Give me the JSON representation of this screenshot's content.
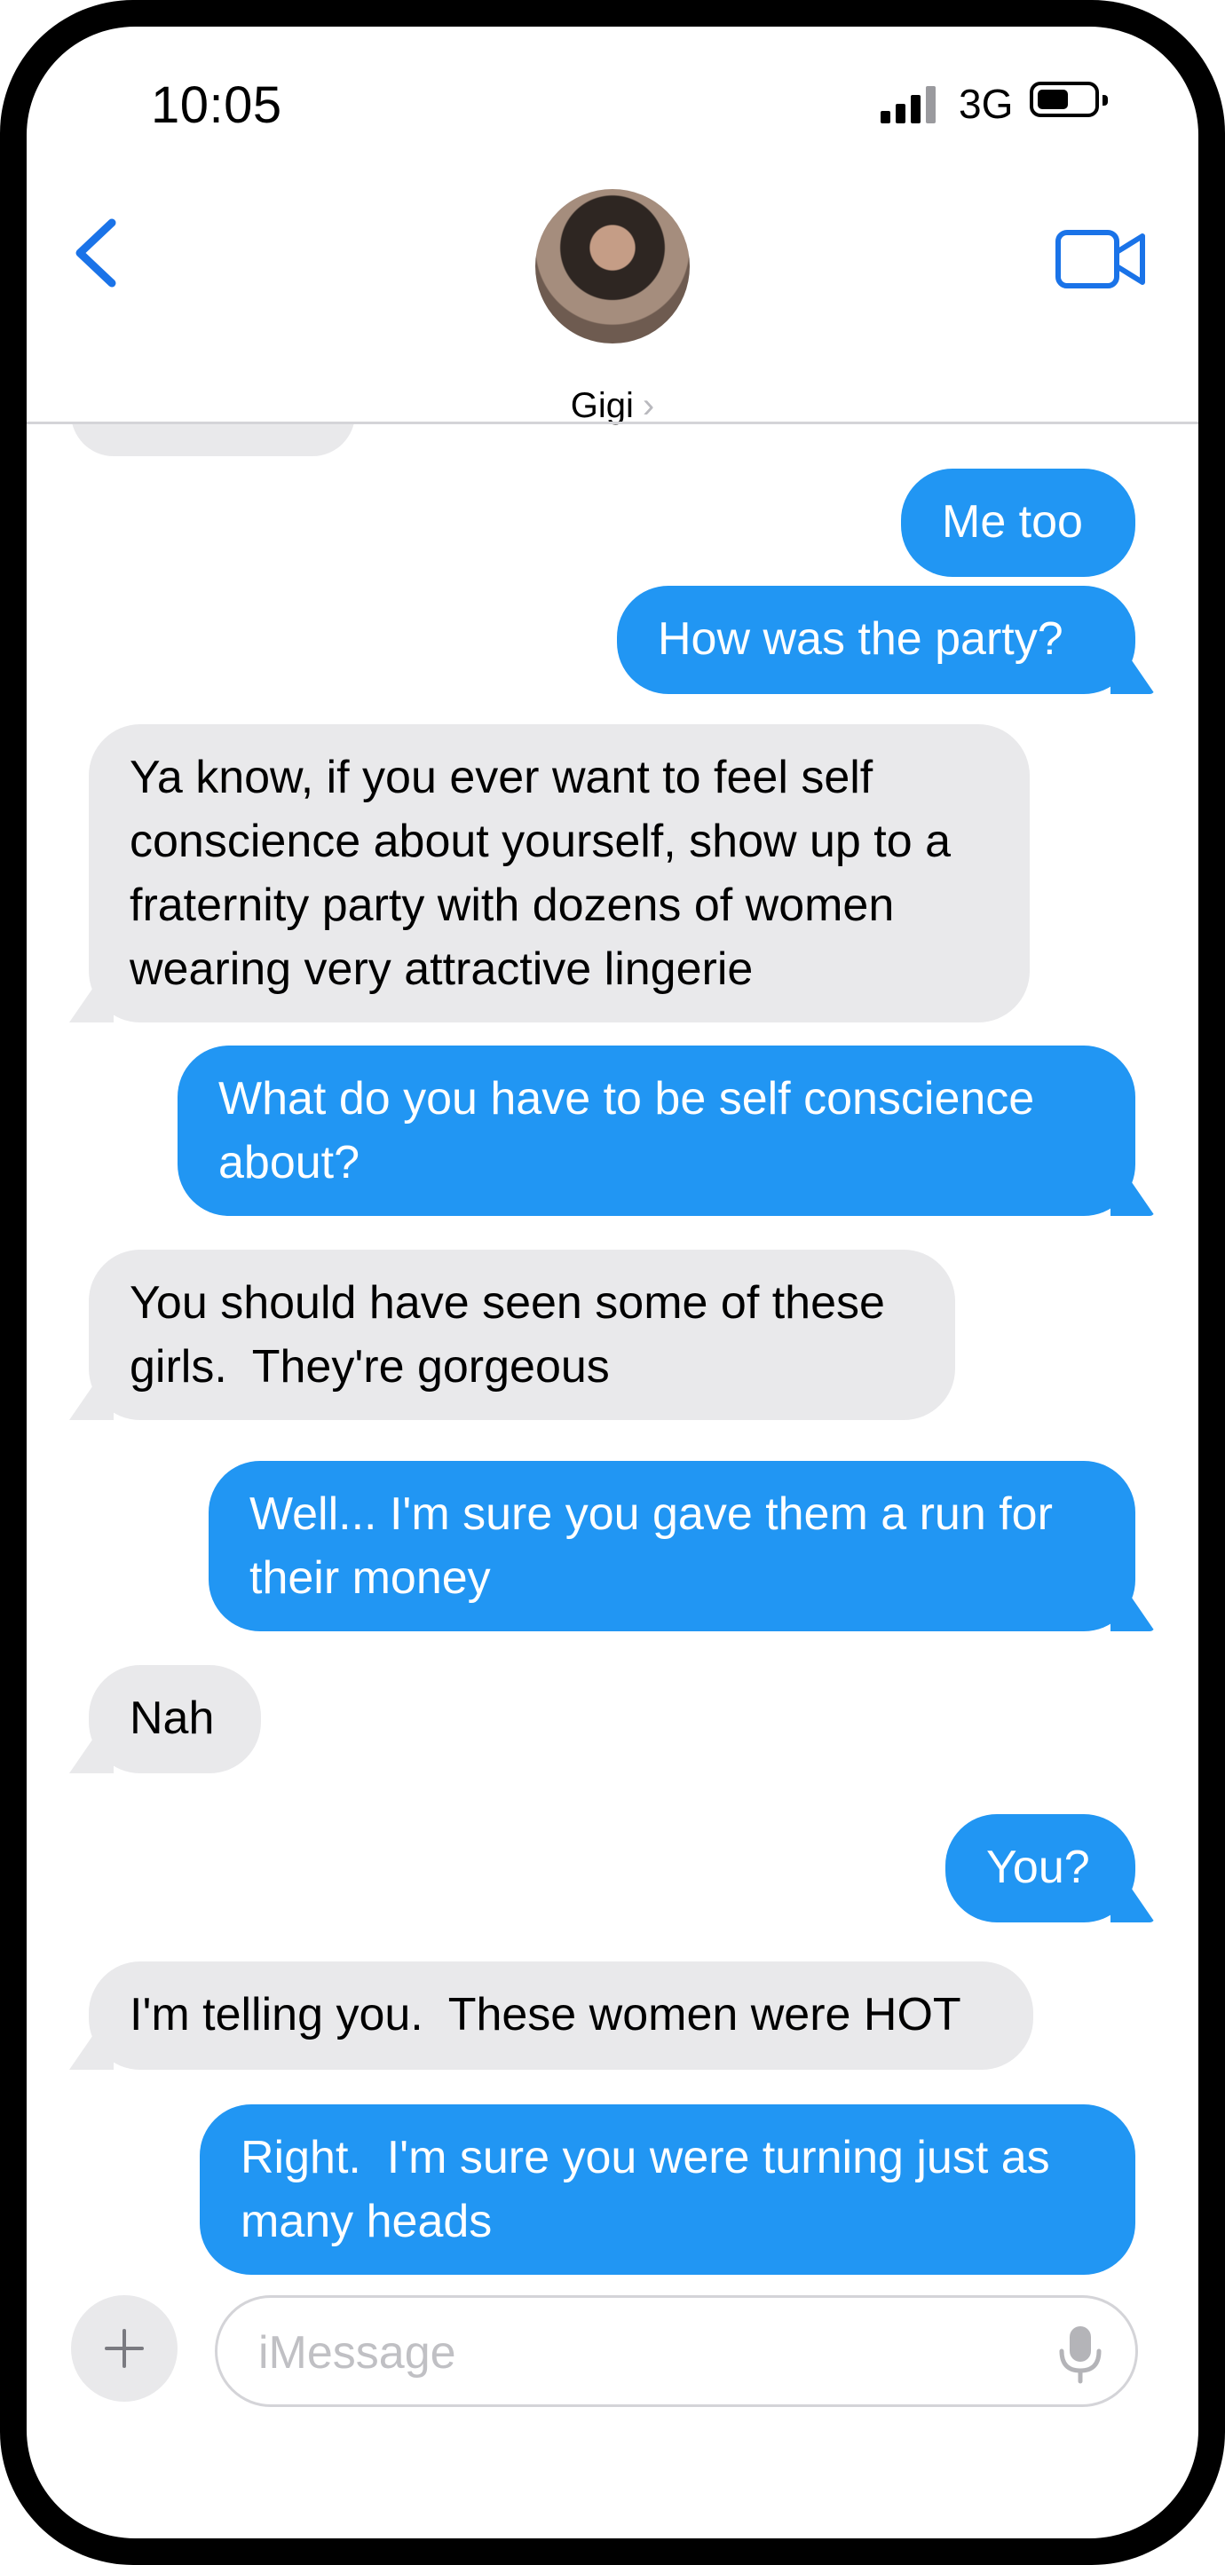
{
  "status_bar": {
    "time": "10:05",
    "network": "3G"
  },
  "header": {
    "contact_name": "Gigi",
    "chevron": "›",
    "back_icon": "chevron-left-icon",
    "video_icon": "video-camera-icon"
  },
  "messages": [
    {
      "side": "sent",
      "text": "Me too"
    },
    {
      "side": "sent",
      "text": "How was the party?"
    },
    {
      "side": "received",
      "text": "Ya know, if you ever want to feel self\nconscience about yourself, show up to a\nfraternity party with dozens of women\nwearing very attractive lingerie"
    },
    {
      "side": "sent",
      "text": "What do you have to be self conscience\nabout?"
    },
    {
      "side": "received",
      "text": "You should have seen some of these\ngirls.  They're gorgeous"
    },
    {
      "side": "sent",
      "text": "Well... I'm sure you gave them a run for\ntheir money"
    },
    {
      "side": "received",
      "text": "Nah"
    },
    {
      "side": "sent",
      "text": "You?"
    },
    {
      "side": "received",
      "text": "I'm telling you.  These women were HOT"
    },
    {
      "side": "sent",
      "text": "Right.  I'm sure you were turning just as\nmany heads"
    }
  ],
  "composer": {
    "placeholder": "iMessage",
    "value": ""
  },
  "colors": {
    "sent_bubble": "#2196f3",
    "received_bubble": "#e9e9eb",
    "accent": "#1a73e8"
  }
}
